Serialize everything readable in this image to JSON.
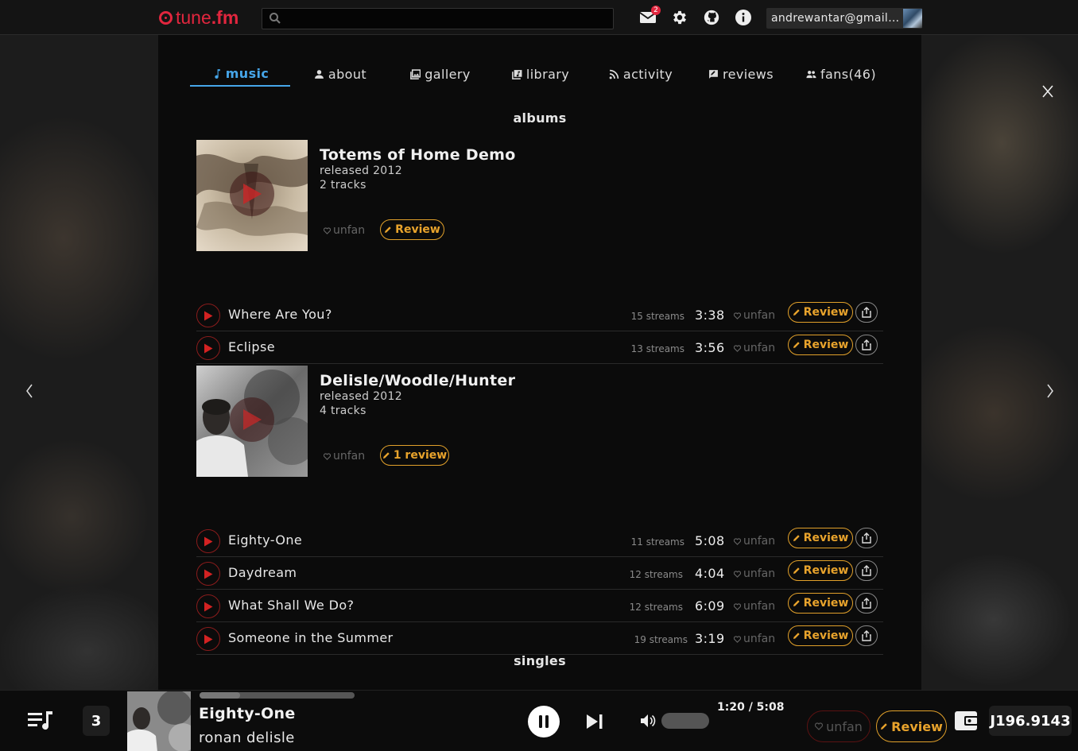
{
  "app": {
    "logo_prefix": "tune",
    "logo_suffix": ".fm"
  },
  "search": {
    "placeholder": ""
  },
  "header": {
    "mail_count": "2",
    "account_email": "andrewantar@gmail.com"
  },
  "tabs": [
    {
      "label": "music",
      "icon": "music-note-icon",
      "active": true
    },
    {
      "label": "about",
      "icon": "person-icon"
    },
    {
      "label": "gallery",
      "icon": "gallery-icon"
    },
    {
      "label": "library",
      "icon": "library-icon"
    },
    {
      "label": "activity",
      "icon": "rss-icon"
    },
    {
      "label": "reviews",
      "icon": "review-icon"
    },
    {
      "label": "fans(46)",
      "icon": "group-icon"
    }
  ],
  "sections": {
    "albums": "albums",
    "singles": "singles"
  },
  "albums": [
    {
      "title": "Totems of Home Demo",
      "released": "released 2012",
      "tracks_count": "2 tracks",
      "unfan": "unfan",
      "review": "Review",
      "tracks": [
        {
          "name": "Where Are You?",
          "streams": "15 streams",
          "duration": "3:38",
          "unfan": "unfan",
          "review": "Review"
        },
        {
          "name": "Eclipse",
          "streams": "13 streams",
          "duration": "3:56",
          "unfan": "unfan",
          "review": "Review"
        }
      ]
    },
    {
      "title": "Delisle/Woodle/Hunter",
      "released": "released 2012",
      "tracks_count": "4 tracks",
      "unfan": "unfan",
      "review": "1 review",
      "tracks": [
        {
          "name": "Eighty-One",
          "streams": "11 streams",
          "duration": "5:08",
          "unfan": "unfan",
          "review": "Review"
        },
        {
          "name": "Daydream",
          "streams": "12 streams",
          "duration": "4:04",
          "unfan": "unfan",
          "review": "Review"
        },
        {
          "name": "What Shall We Do?",
          "streams": "12 streams",
          "duration": "6:09",
          "unfan": "unfan",
          "review": "Review"
        },
        {
          "name": "Someone in the Summer",
          "streams": "19 streams",
          "duration": "3:19",
          "unfan": "unfan",
          "review": "Review"
        }
      ]
    }
  ],
  "player": {
    "queue_count": "3",
    "title": "Eighty-One",
    "artist": "ronan delisle",
    "time": "1:20 / 5:08",
    "progress": 0.26,
    "unfan": "unfan",
    "review": "Review",
    "balance": "J196.9143"
  },
  "colors": {
    "brand": "#e2263e",
    "accent": "#46a6ea",
    "review": "#e8a32c"
  }
}
